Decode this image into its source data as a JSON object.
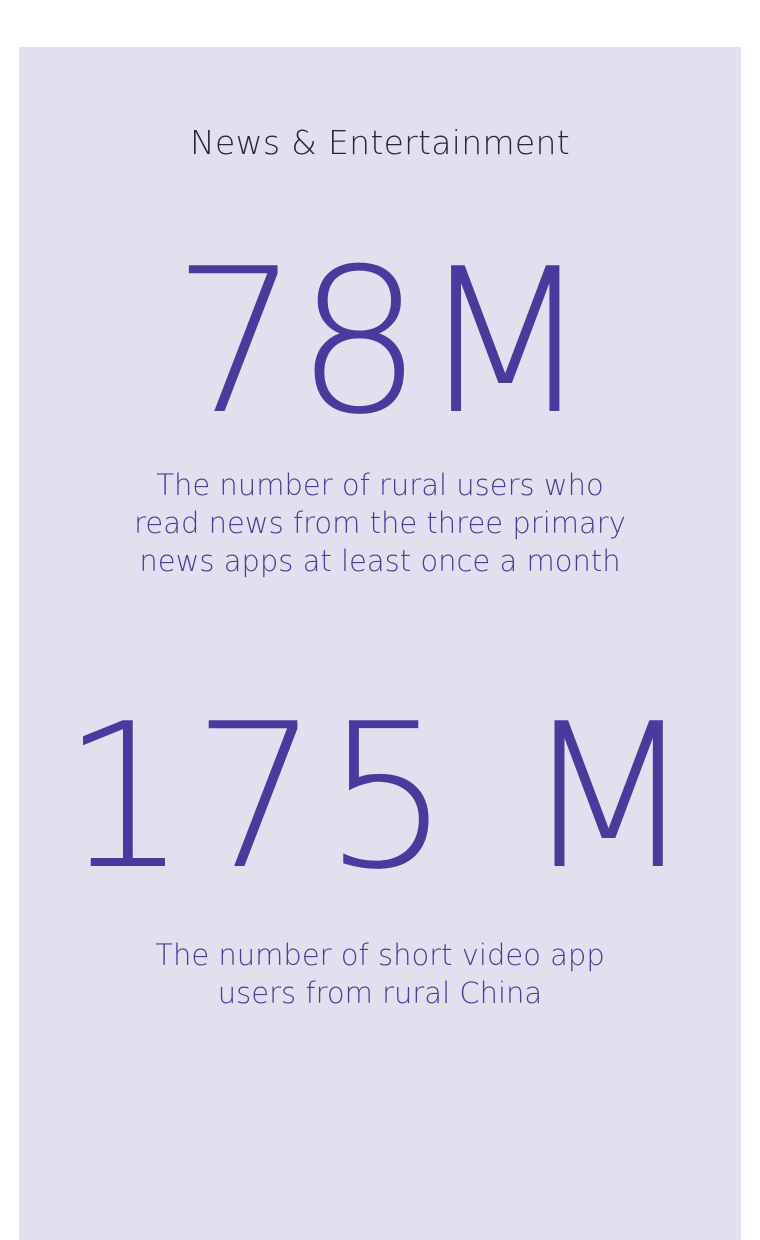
{
  "card": {
    "heading": "News & Entertainment",
    "colors": {
      "background": "#e2e0ee",
      "accent": "#4a3a9e",
      "heading_text": "#28263a"
    },
    "stats": [
      {
        "value": "78M",
        "description_lines": [
          "The number of rural users who",
          "read news from the three primary",
          "news apps at least once a month"
        ]
      },
      {
        "value": "175 M",
        "description_lines": [
          "The number of short video app",
          "users from rural China"
        ]
      }
    ]
  }
}
